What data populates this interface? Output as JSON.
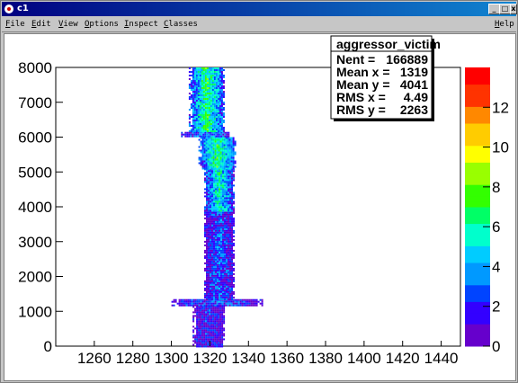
{
  "window": {
    "title": "c1",
    "buttons": {
      "minimize": "_",
      "maximize": "□",
      "close": "x"
    }
  },
  "menubar": {
    "items": [
      {
        "label": "File",
        "accel": "F"
      },
      {
        "label": "Edit",
        "accel": "E"
      },
      {
        "label": "View",
        "accel": "V"
      },
      {
        "label": "Options",
        "accel": "O"
      },
      {
        "label": "Inspect",
        "accel": "I"
      },
      {
        "label": "Classes",
        "accel": "C"
      }
    ],
    "help": "Help"
  },
  "colors": {
    "frame_fill": "#ffffff",
    "palette": [
      "#ffffff",
      "#6600cc",
      "#3300ff",
      "#0044ff",
      "#0099ff",
      "#00ccff",
      "#00ffcc",
      "#00ff66",
      "#33ff00",
      "#99ff00",
      "#ffff00",
      "#ffcc00",
      "#ff8800",
      "#ff3300",
      "#ff0000"
    ]
  },
  "stats_box": {
    "title": "aggressor_victim",
    "rows": [
      {
        "label": "Nent = ",
        "value": "166889"
      },
      {
        "label": "Mean x = ",
        "value": "1319"
      },
      {
        "label": "Mean y = ",
        "value": "4041"
      },
      {
        "label": "RMS x = ",
        "value": "4.49"
      },
      {
        "label": "RMS y = ",
        "value": "2263"
      }
    ]
  },
  "chart_data": {
    "type": "heatmap",
    "title": "",
    "xlabel": "",
    "ylabel": "",
    "xlim": [
      1240,
      1450
    ],
    "ylim": [
      0,
      8000
    ],
    "x_tick_labels": [
      "1260",
      "1280",
      "1300",
      "1320",
      "1340",
      "1360",
      "1380",
      "1400",
      "1420",
      "1440"
    ],
    "x_tick_values": [
      1260,
      1280,
      1300,
      1320,
      1340,
      1360,
      1380,
      1400,
      1420,
      1440
    ],
    "y_tick_labels": [
      "0",
      "1000",
      "2000",
      "3000",
      "4000",
      "5000",
      "6000",
      "7000",
      "8000"
    ],
    "y_tick_values": [
      0,
      1000,
      2000,
      3000,
      4000,
      5000,
      6000,
      7000,
      8000
    ],
    "z_range": [
      0,
      14
    ],
    "z_tick_labels": [
      "0",
      "2",
      "4",
      "6",
      "8",
      "10",
      "12"
    ],
    "z_tick_values": [
      0,
      2,
      4,
      6,
      8,
      10,
      12
    ],
    "bands": [
      {
        "y": [
          0,
          1150
        ],
        "x": [
          1311,
          1327
        ],
        "level": 2
      },
      {
        "y": [
          1150,
          1350
        ],
        "x": [
          1300,
          1347
        ],
        "level": 3
      },
      {
        "y": [
          1350,
          3900
        ],
        "x": [
          1317,
          1332
        ],
        "level": 3
      },
      {
        "y": [
          3900,
          5100
        ],
        "x": [
          1317,
          1332
        ],
        "level": 6
      },
      {
        "y": [
          5100,
          6000
        ],
        "x": [
          1314,
          1333
        ],
        "level": 7
      },
      {
        "y": [
          6000,
          6150
        ],
        "x": [
          1305,
          1330
        ],
        "level": 4
      },
      {
        "y": [
          6150,
          8000
        ],
        "x": [
          1309,
          1327
        ],
        "level": 7
      }
    ]
  }
}
